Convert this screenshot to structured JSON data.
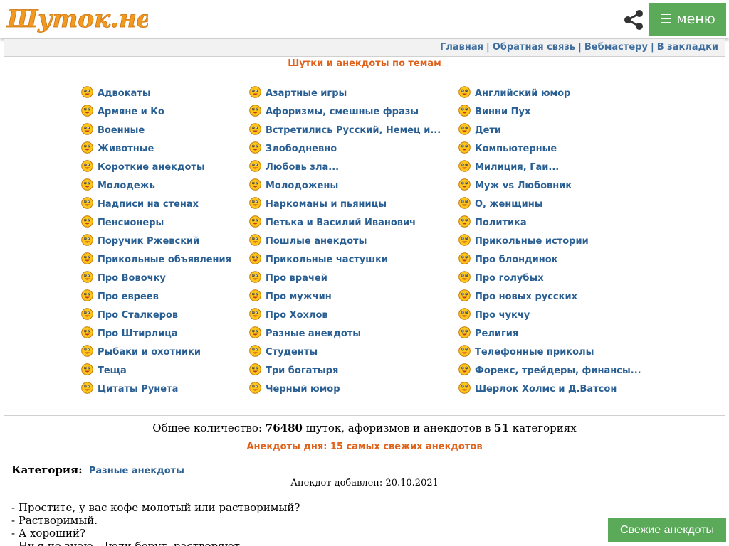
{
  "header": {
    "logo_text": "Шуток.нет",
    "menu_icon": "☰",
    "menu_label": "меню",
    "share_icon": "share-icon"
  },
  "toplinks": {
    "items": [
      "Главная",
      "Обратная связь",
      "Вебмастеру",
      "В закладки"
    ],
    "separator": "|"
  },
  "categories": {
    "title": "Шутки и анекдоты по темам",
    "columns": [
      [
        "Адвокаты",
        "Армяне и Ко",
        "Военные",
        "Животные",
        "Короткие анекдоты",
        "Молодежь",
        "Надписи на стенах",
        "Пенсионеры",
        "Поручик Ржевский",
        "Прикольные объявления",
        "Про Вовочку",
        "Про евреев",
        "Про Сталкеров",
        "Про Штирлица",
        "Рыбаки и охотники",
        "Теща",
        "Цитаты Рунета"
      ],
      [
        "Азартные игры",
        "Афоризмы, смешные фразы",
        "Встретились Русский, Немец и...",
        "Злободневно",
        "Любовь зла...",
        "Молодожены",
        "Наркоманы и пьяницы",
        "Петька и Василий Иванович",
        "Пошлые анекдоты",
        "Прикольные частушки",
        "Про врачей",
        "Про мужчин",
        "Про Хохлов",
        "Разные анекдоты",
        "Студенты",
        "Три богатыря",
        "Черный юмор"
      ],
      [
        "Английский юмор",
        "Винни Пух",
        "Дети",
        "Компьютерные",
        "Милиция, Гаи...",
        "Муж vs Любовник",
        "О, женщины",
        "Политика",
        "Прикольные истории",
        "Про блондинок",
        "Про голубых",
        "Про новых русских",
        "Про чукчу",
        "Религия",
        "Телефонные приколы",
        "Форекс, трейдеры, финансы...",
        "Шерлок Холмс и Д.Ватсон"
      ]
    ]
  },
  "stats": {
    "prefix": "Общее количество: ",
    "total": "76480",
    "middle": " шуток, афоризмов и анекдотов в ",
    "categories_count": "51",
    "suffix": " категориях"
  },
  "fresh_title": "Анекдоты дня: 15 самых свежих анекдотов",
  "joke": {
    "category_label": "Категория:",
    "category_value": "Разные анекдоты",
    "date_text": "Анекдот добавлен: 20.10.2021",
    "lines": [
      "- Простите, у вас кофе молотый или растворимый?",
      "- Растворимый.",
      "- А хороший?",
      "- Ну я не знаю. Люди берут, растворяют..."
    ]
  },
  "fresh_button": "Свежие анекдоты",
  "colors": {
    "accent_green": "#5aaa5a",
    "link_blue": "#2a5f93",
    "title_orange": "#e0621a",
    "logo_orange": "#f29a1f"
  }
}
